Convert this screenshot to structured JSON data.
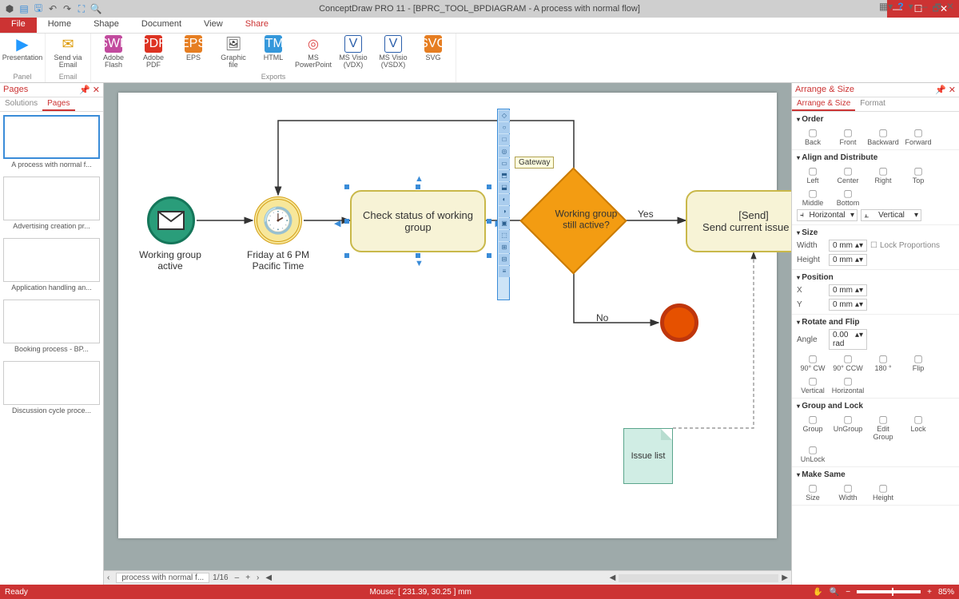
{
  "titlebar": {
    "title": "ConceptDraw PRO 11 - [BPRC_TOOL_BPDIAGRAM - A process with normal flow]"
  },
  "menu": {
    "file": "File",
    "tabs": [
      "Home",
      "Shape",
      "Document",
      "View",
      "Share"
    ],
    "active": "Share"
  },
  "ribbon": {
    "groups": [
      {
        "label": "Panel",
        "items": [
          {
            "label": "Presentation",
            "icon": "▶"
          }
        ]
      },
      {
        "label": "Email",
        "items": [
          {
            "label": "Send via\nEmail",
            "icon": "✉"
          }
        ]
      },
      {
        "label": "Exports",
        "items": [
          {
            "label": "Adobe\nFlash",
            "icon": "SWF",
            "cls": "ic-swf"
          },
          {
            "label": "Adobe\nPDF",
            "icon": "PDF",
            "cls": "ic-pdf"
          },
          {
            "label": "EPS",
            "icon": "EPS",
            "cls": "ic-eps"
          },
          {
            "label": "Graphic\nfile",
            "icon": "🖼"
          },
          {
            "label": "HTML",
            "icon": "HTML",
            "cls": "ic-html"
          },
          {
            "label": "MS\nPowerPoint",
            "icon": "◎",
            "cls": "ic-ppt"
          },
          {
            "label": "MS Visio\n(VDX)",
            "icon": "V",
            "cls": "ic-vx"
          },
          {
            "label": "MS Visio\n(VSDX)",
            "icon": "V",
            "cls": "ic-vx"
          },
          {
            "label": "SVG",
            "icon": "SVG",
            "cls": "ic-svg"
          }
        ]
      }
    ]
  },
  "pagesPanel": {
    "title": "Pages",
    "tabs": {
      "solutions": "Solutions",
      "pages": "Pages"
    },
    "thumbs": [
      {
        "label": "A process with normal f...",
        "selected": true
      },
      {
        "label": "Advertising creation pr..."
      },
      {
        "label": "Application handling an..."
      },
      {
        "label": "Booking  process - BP..."
      },
      {
        "label": "Discussion cycle proce..."
      }
    ]
  },
  "diagram": {
    "start": {
      "label": "Working\ngroup\nactive"
    },
    "timer": {
      "label": "Friday at\n6 PM\nPacific Time"
    },
    "task1": "Check status of working group",
    "gateway": "Working group\nstill active?",
    "tooltip": "Gateway",
    "yes": "Yes",
    "no": "No",
    "task2": "[Send]\nSend current issue list",
    "dataObj": "Issue list"
  },
  "pageTab": {
    "name": "process with normal f...",
    "index": "1/16"
  },
  "rightPanel": {
    "title": "Arrange & Size",
    "tabs": {
      "arrange": "Arrange & Size",
      "format": "Format"
    },
    "order": {
      "head": "Order",
      "btns": [
        "Back",
        "Front",
        "Backward",
        "Forward"
      ]
    },
    "align": {
      "head": "Align and Distribute",
      "btns": [
        "Left",
        "Center",
        "Right",
        "Top",
        "Middle",
        "Bottom"
      ],
      "horiz": "Horizontal",
      "vert": "Vertical"
    },
    "size": {
      "head": "Size",
      "width": "Width",
      "height": "Height",
      "wval": "0 mm",
      "hval": "0 mm",
      "lock": "Lock Proportions"
    },
    "pos": {
      "head": "Position",
      "x": "X",
      "y": "Y",
      "xval": "0 mm",
      "yval": "0 mm"
    },
    "rotate": {
      "head": "Rotate and Flip",
      "angle": "Angle",
      "aval": "0.00 rad",
      "btns": [
        "90° CW",
        "90° CCW",
        "180 °",
        "Flip",
        "Vertical",
        "Horizontal"
      ]
    },
    "group": {
      "head": "Group and Lock",
      "btns": [
        "Group",
        "UnGroup",
        "Edit Group",
        "Lock",
        "UnLock"
      ]
    },
    "same": {
      "head": "Make Same",
      "btns": [
        "Size",
        "Width",
        "Height"
      ]
    }
  },
  "status": {
    "ready": "Ready",
    "mouse": "Mouse: [ 231.39, 30.25 ] mm",
    "zoom": "85%"
  }
}
